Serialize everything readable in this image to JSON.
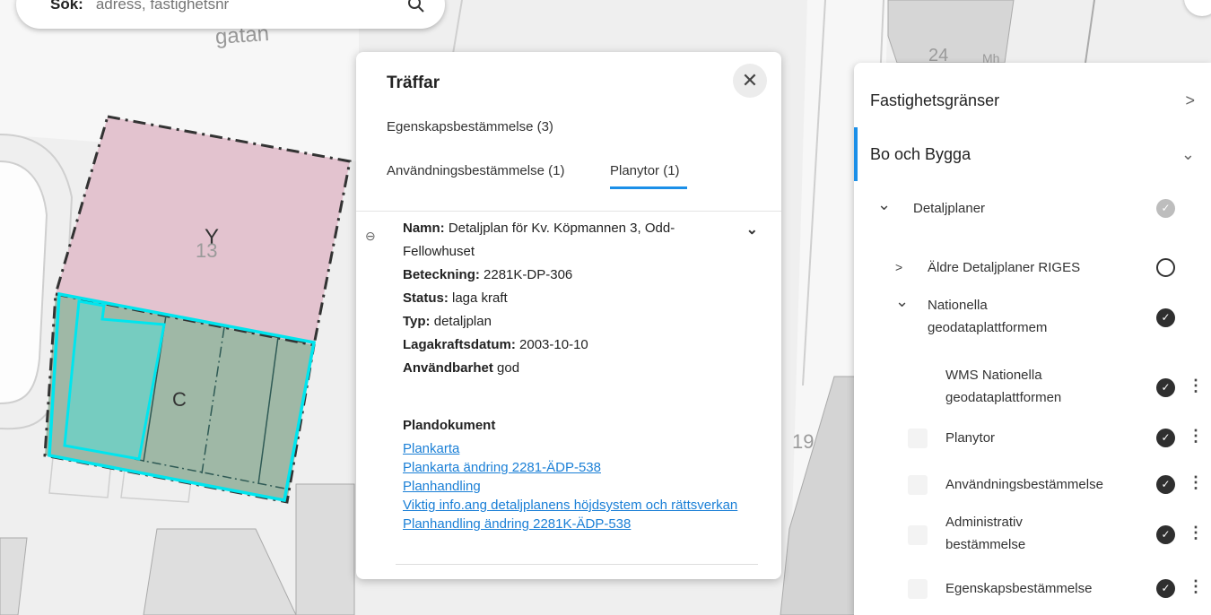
{
  "search": {
    "label": "Sök:",
    "placeholder": "adress, fastighetsnr"
  },
  "map": {
    "street_label": "gatan",
    "labels": [
      "Y",
      "13",
      "C",
      "19",
      "24",
      "Mh"
    ]
  },
  "results": {
    "title": "Träffar",
    "tabs": [
      "Egenskapsbestämmelse (3)",
      "Användningsbestämmelse (1)",
      "Planytor (1)"
    ],
    "active_tab": "Planytor (1)",
    "properties": [
      {
        "key": "Namn:",
        "value": " Detaljplan för Kv. Köpmannen 3, Odd-Fellowhuset"
      },
      {
        "key": "Beteckning:",
        "value": " 2281K-DP-306"
      },
      {
        "key": "Status:",
        "value": " laga kraft"
      },
      {
        "key": "Typ:",
        "value": " detaljplan"
      },
      {
        "key": "Lagakraftsdatum:",
        "value": " 2003-10-10"
      },
      {
        "key": "Användbarhet",
        "value": " god"
      }
    ],
    "documents_title": "Plandokument",
    "documents": [
      "Plankarta",
      "Plankarta ändring 2281-ÄDP-538",
      "Planhandling",
      "Viktig info.ang detaljplanens höjdsystem och rättsverkan",
      "Planhandling ändring 2281K-ÄDP-538"
    ]
  },
  "layers": {
    "groups": [
      {
        "label": "Fastighetsgränser",
        "expanded": false
      },
      {
        "label": "Bo och Bygga",
        "expanded": true
      }
    ],
    "items": [
      {
        "label": "Detaljplaner",
        "state": "partial"
      },
      {
        "label": "Äldre Detaljplaner RIGES",
        "state": "off"
      },
      {
        "label": "Nationella geodataplattformem",
        "state": "on"
      },
      {
        "label": "WMS Nationella geodataplattformen",
        "state": "on"
      },
      {
        "label": "Planytor",
        "state": "on"
      },
      {
        "label": "Användningsbestämmelse",
        "state": "on"
      },
      {
        "label": "Administrativ bestämmelse",
        "state": "on"
      },
      {
        "label": "Egenskapsbestämmelse",
        "state": "on"
      }
    ]
  },
  "colors": {
    "accent": "#1b8fe8",
    "highlight": "#00e5ee",
    "parcel_y": "#e3c3cf",
    "parcel_c": "#9fb8a6"
  }
}
